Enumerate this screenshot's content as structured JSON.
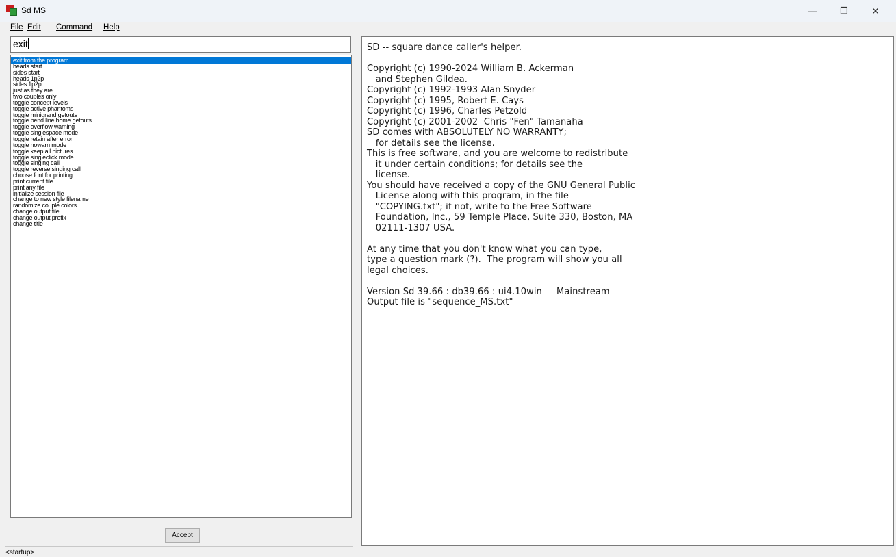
{
  "window": {
    "title": "Sd MS",
    "minimize_glyph": "—",
    "maximize_glyph": "❐",
    "close_glyph": "✕"
  },
  "menu": {
    "items": [
      "File",
      "Edit",
      "Command",
      "Help"
    ]
  },
  "command_input": {
    "value": "exit"
  },
  "command_list": {
    "selected_index": 0,
    "items": [
      "exit from the program",
      "heads start",
      "sides start",
      "heads 1p2p",
      "sides 1p2p",
      "just as they are",
      "two couples only",
      "toggle concept levels",
      "toggle active phantoms",
      "toggle minigrand getouts",
      "toggle bend line home getouts",
      "toggle overflow warning",
      "toggle singlespace mode",
      "toggle retain after error",
      "toggle nowarn mode",
      "toggle keep all pictures",
      "toggle singleclick mode",
      "toggle singing call",
      "toggle reverse singing call",
      "choose font for printing",
      "print current file",
      "print any file",
      "initialize session file",
      "change to new style filename",
      "randomize couple colors",
      "change output file",
      "change output prefix",
      "change title"
    ]
  },
  "accept_button": {
    "label": "Accept"
  },
  "status_bar": {
    "text": "<startup>"
  },
  "transcript": {
    "lines": [
      "SD -- square dance caller's helper.",
      "",
      "Copyright (c) 1990-2024 William B. Ackerman",
      "   and Stephen Gildea.",
      "Copyright (c) 1992-1993 Alan Snyder",
      "Copyright (c) 1995, Robert E. Cays",
      "Copyright (c) 1996, Charles Petzold",
      "Copyright (c) 2001-2002  Chris \"Fen\" Tamanaha",
      "SD comes with ABSOLUTELY NO WARRANTY;",
      "   for details see the license.",
      "This is free software, and you are welcome to redistribute",
      "   it under certain conditions; for details see the",
      "   license.",
      "You should have received a copy of the GNU General Public",
      "   License along with this program, in the file",
      "   \"COPYING.txt\"; if not, write to the Free Software",
      "   Foundation, Inc., 59 Temple Place, Suite 330, Boston, MA",
      "   02111-1307 USA.",
      "",
      "At any time that you don't know what you can type,",
      "type a question mark (?).  The program will show you all",
      "legal choices.",
      "",
      "Version Sd 39.66 : db39.66 : ui4.10win     Mainstream",
      "Output file is \"sequence_MS.txt\""
    ]
  },
  "colors": {
    "selection": "#0078d7",
    "titlebar": "#eff3f8",
    "window_bg": "#f0f0f0"
  }
}
